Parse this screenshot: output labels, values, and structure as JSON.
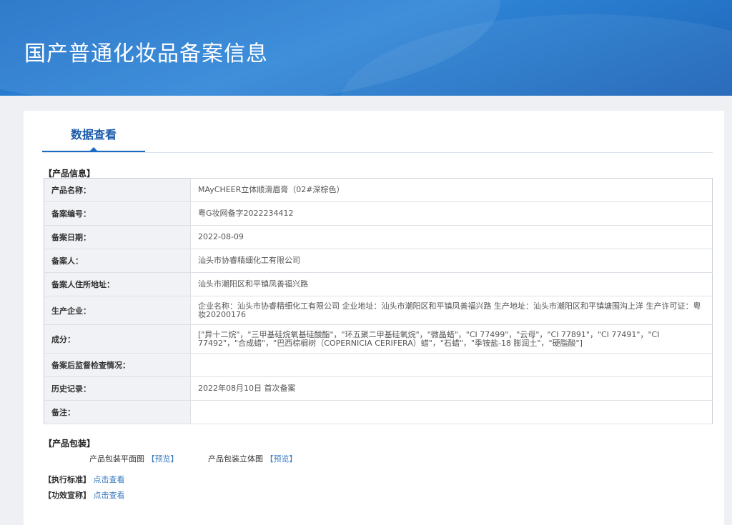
{
  "header": {
    "title": "国产普通化妆品备案信息"
  },
  "tabs": [
    {
      "label": "数据查看"
    }
  ],
  "product_info": {
    "section_label": "【产品信息】",
    "rows": [
      {
        "label": "产品名称：",
        "value": "MAyCHEER立体顺滑眉膏（02#深棕色）"
      },
      {
        "label": "备案编号：",
        "value": "粤G妆网备字2022234412"
      },
      {
        "label": "备案日期：",
        "value": "2022-08-09"
      },
      {
        "label": "备案人：",
        "value": "汕头市协睿精细化工有限公司"
      },
      {
        "label": "备案人住所地址：",
        "value": "汕头市潮阳区和平镇凤善福兴路"
      },
      {
        "label": "生产企业：",
        "value": "企业名称：汕头市协睿精细化工有限公司 企业地址：汕头市潮阳区和平镇凤善福兴路 生产地址：汕头市潮阳区和平镇塘围沟上洋 生产许可证：粤妆20200176"
      },
      {
        "label": "成分：",
        "value": "[\"异十二烷\"，\"三甲基硅烷氧基硅酸酯\"，\"环五聚二甲基硅氧烷\"，\"微晶蜡\"，\"CI 77499\"，\"云母\"，\"CI 77891\"，\"CI 77491\"，\"CI 77492\"，\"合成蜡\"，\"巴西棕榈树（COPERNICIA CERIFERA）蜡\"，\"石蜡\"，\"季铵盐-18 膨润土\"，\"硬脂酸\"]"
      },
      {
        "label": "备案后监督检查情况：",
        "value": ""
      },
      {
        "label": "历史记录：",
        "value": "2022年08月10日 首次备案"
      },
      {
        "label": "备注：",
        "value": ""
      }
    ]
  },
  "packaging": {
    "section_label": "【产品包装】",
    "flat_label": "产品包装平面图",
    "flat_link": "【预览】",
    "solid_label": "产品包装立体图",
    "solid_link": "【预览】"
  },
  "standard": {
    "label": "【执行标准】",
    "link": "点击查看"
  },
  "efficacy": {
    "label": "【功效宣称】",
    "link": "点击查看"
  },
  "colors": {
    "banner": "#2f86d8",
    "accent": "#1a6bc2",
    "link": "#3a79c0"
  }
}
